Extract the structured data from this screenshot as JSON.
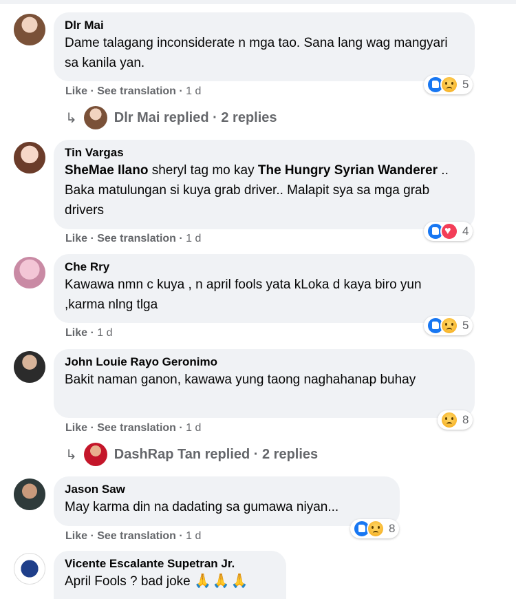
{
  "actions": {
    "like": "Like",
    "see_translation": "See translation",
    "separator": " · "
  },
  "comments": [
    {
      "author": "Dlr Mai",
      "text": "Dame talagang inconsiderate n mga tao. Sana lang wag mangyari sa kanila yan.",
      "time": "1 d",
      "reactions": [
        "like",
        "sad"
      ],
      "reaction_count": "5",
      "replies_label": "Dlr Mai replied · 2 replies"
    },
    {
      "author": "Tin Vargas",
      "mention1": "SheMae Ilano",
      "text_a": " sheryl tag mo kay ",
      "mention2": "The Hungry Syrian Wanderer",
      "text_b": " .. Baka matulungan si kuya grab driver.. Malapit sya sa mga grab drivers",
      "time": "1 d",
      "reactions": [
        "like",
        "love"
      ],
      "reaction_count": "4"
    },
    {
      "author": "Che Rry",
      "text": "Kawawa nmn c kuya , n april fools yata kLoka d kaya biro yun ,karma nlng tlga",
      "time": "1 d",
      "reactions": [
        "like",
        "sad"
      ],
      "reaction_count": "5"
    },
    {
      "author": "John Louie Rayo Geronimo",
      "text": "Bakit naman ganon, kawawa yung taong naghahanap buhay",
      "time": "1 d",
      "reactions": [
        "sad"
      ],
      "reaction_count": "8",
      "replies_label": "DashRap Tan replied · 2 replies"
    },
    {
      "author": "Jason Saw",
      "text": "May karma din na dadating sa gumawa niyan...",
      "time": "1 d",
      "reactions": [
        "like",
        "sad"
      ],
      "reaction_count": "8"
    },
    {
      "author": "Vicente Escalante Supetran Jr.",
      "text": "April Fools ? bad joke",
      "emoji": "🙏🙏🙏"
    }
  ]
}
